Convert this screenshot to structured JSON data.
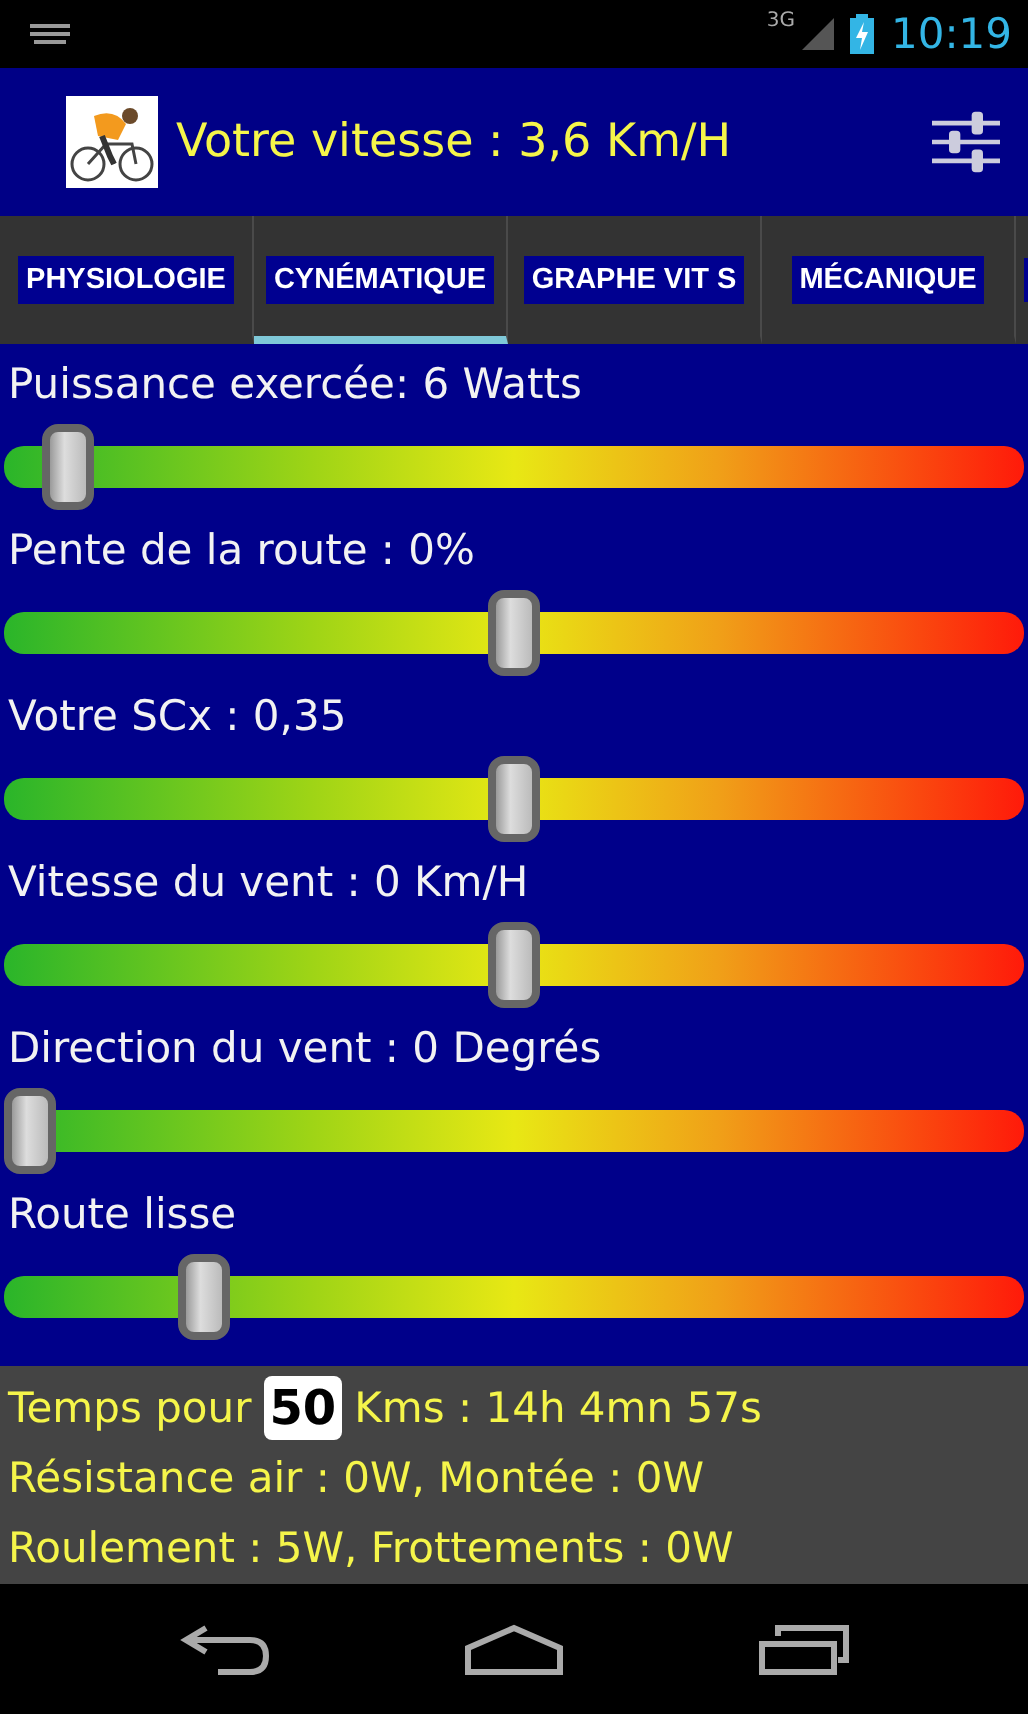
{
  "status_bar": {
    "time": "10:19",
    "network": "3G"
  },
  "action_bar": {
    "title": "Votre vitesse : 3,6 Km/H"
  },
  "tabs": [
    {
      "label": "PHYSIOLOGIE",
      "selected": false
    },
    {
      "label": "CYNÉMATIQUE",
      "selected": true
    },
    {
      "label": "GRAPHE VIT S",
      "selected": false
    },
    {
      "label": "MÉCANIQUE",
      "selected": false
    }
  ],
  "sliders": [
    {
      "label": "Puissance exercée: 6 Watts",
      "level": 0.04
    },
    {
      "label": "Pente de la route : 0%",
      "level": 0.5
    },
    {
      "label": "Votre SCx : 0,35",
      "level": 0.5
    },
    {
      "label": "Vitesse du vent : 0 Km/H",
      "level": 0.5
    },
    {
      "label": "Direction du vent : 0 Degrés",
      "level": 0.0
    },
    {
      "label": "Route lisse",
      "level": 0.18
    }
  ],
  "results": {
    "time_prefix": "Temps pour",
    "distance": "50",
    "time_suffix": "Kms : 14h 4mn 57s",
    "lines": [
      "Résistance air : 0W, Montée : 0W",
      "Roulement : 5W, Frottements : 0W"
    ]
  }
}
